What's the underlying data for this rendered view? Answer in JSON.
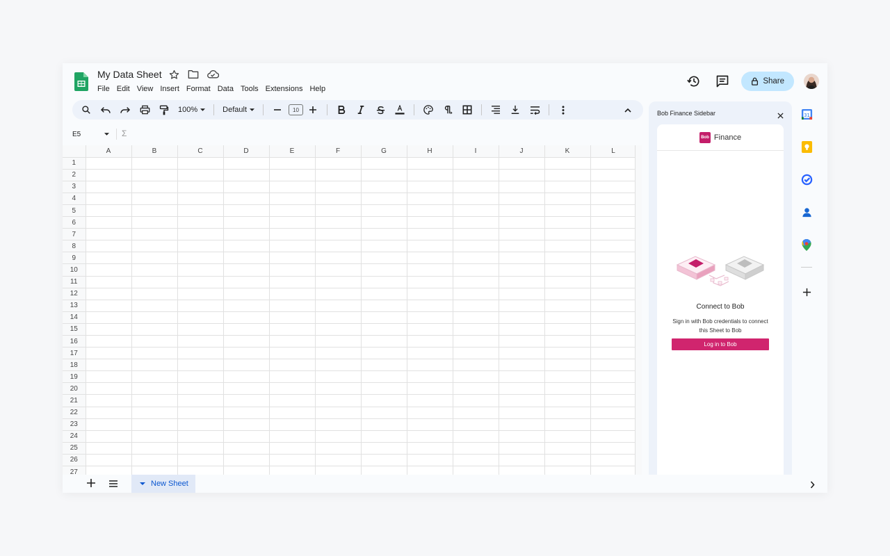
{
  "app": {
    "title": "My Data Sheet"
  },
  "menu": [
    "File",
    "Edit",
    "View",
    "Insert",
    "Format",
    "Data",
    "Tools",
    "Extensions",
    "Help"
  ],
  "header": {
    "share_label": "Share"
  },
  "toolbar": {
    "zoom": "100%",
    "font": "Default",
    "font_size": "10"
  },
  "formula_bar": {
    "cell_ref": "E5",
    "function_symbol": "Σ"
  },
  "grid": {
    "columns": [
      "A",
      "B",
      "C",
      "D",
      "E",
      "F",
      "G",
      "H",
      "I",
      "J",
      "K",
      "L"
    ],
    "rows": [
      "1",
      "2",
      "3",
      "4",
      "5",
      "6",
      "7",
      "8",
      "9",
      "10",
      "11",
      "12",
      "13",
      "14",
      "15",
      "16",
      "17",
      "18",
      "19",
      "20",
      "21",
      "22",
      "23",
      "24",
      "25",
      "26",
      "27"
    ]
  },
  "sheet_tabs": [
    {
      "label": "New Sheet",
      "active": true
    }
  ],
  "sidebar": {
    "title": "Bob Finance Sidebar",
    "brand_logo_text": "Bob",
    "brand_name": "Finance",
    "heading": "Connect to Bob",
    "description": "Sign in with Bob credentials to connect this Sheet to Bob",
    "button_label": "Log in to Bob",
    "accent_color": "#d0256e"
  }
}
